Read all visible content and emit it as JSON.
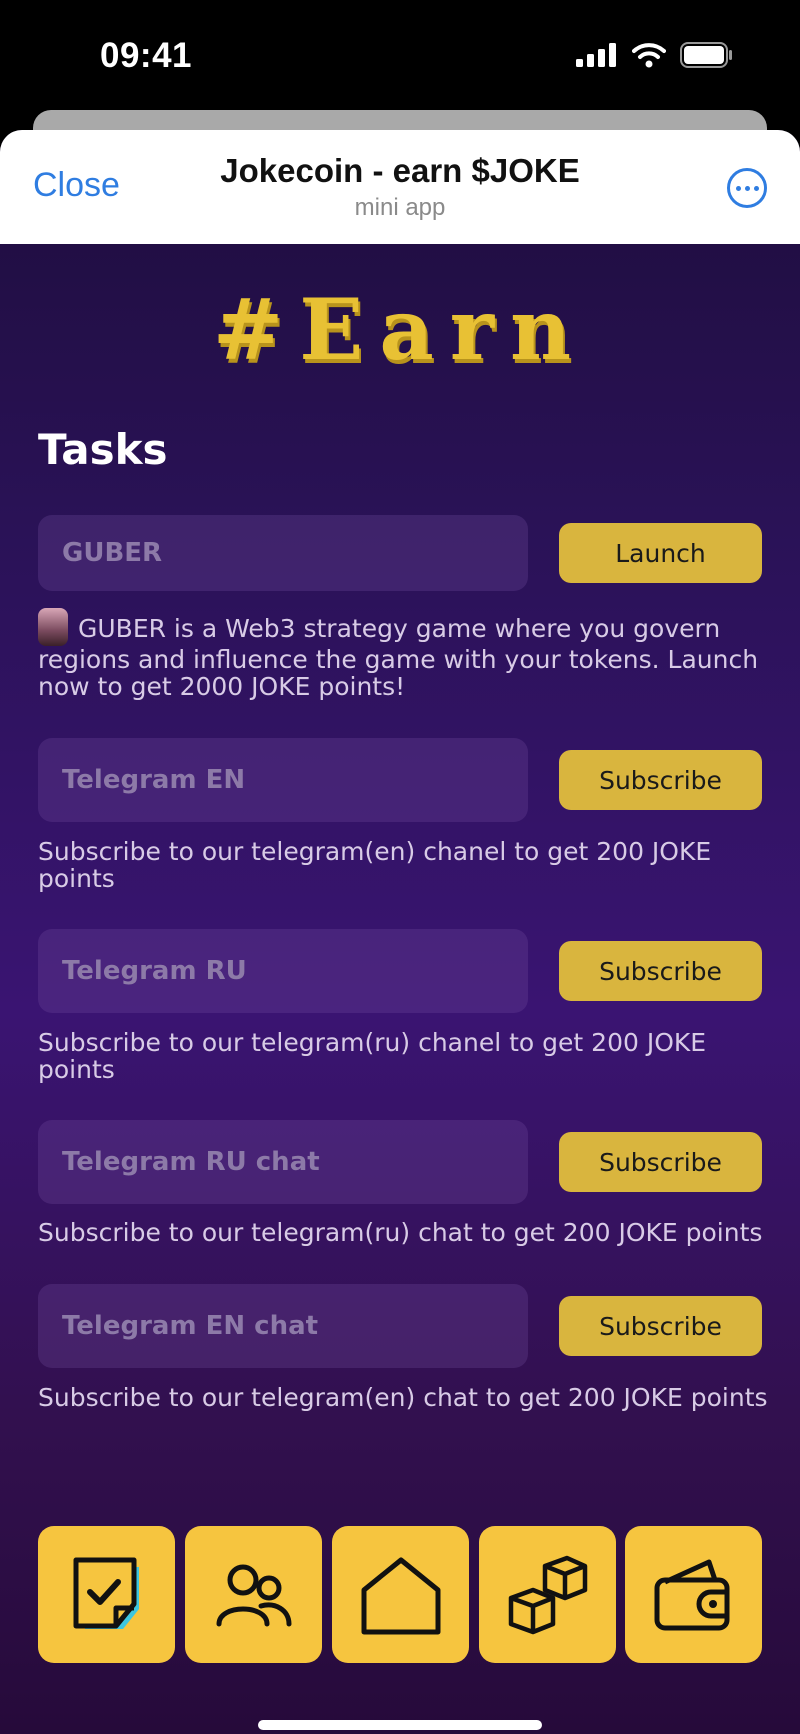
{
  "status_bar": {
    "time": "09:41"
  },
  "header": {
    "close_label": "Close",
    "title": "Jokecoin - earn $JOKE",
    "subtitle": "mini app"
  },
  "earn_logo": "#Earn",
  "tasks_title": "Tasks",
  "tasks": [
    {
      "name": "GUBER",
      "button": "Launch",
      "description": "GUBER is a Web3 strategy game where you govern regions and influence the game with your tokens. Launch now to get 2000 JOKE points!"
    },
    {
      "name": "Telegram EN",
      "button": "Subscribe",
      "description": "Subscribe to our telegram(en) chanel to get 200 JOKE points"
    },
    {
      "name": "Telegram RU",
      "button": "Subscribe",
      "description": "Subscribe to our telegram(ru) chanel to get 200 JOKE points"
    },
    {
      "name": "Telegram RU chat",
      "button": "Subscribe",
      "description": "Subscribe to our telegram(ru) chat to get 200 JOKE points"
    },
    {
      "name": "Telegram EN chat",
      "button": "Subscribe",
      "description": "Subscribe to our telegram(en) chat to get 200 JOKE points"
    }
  ],
  "nav": [
    {
      "icon": "tasks-icon",
      "active": true
    },
    {
      "icon": "friends-icon"
    },
    {
      "icon": "home-icon"
    },
    {
      "icon": "boxes-icon"
    },
    {
      "icon": "wallet-icon"
    }
  ],
  "colors": {
    "accent": "#f6c53f",
    "button": "#d9b53e",
    "link": "#2f7de1"
  }
}
